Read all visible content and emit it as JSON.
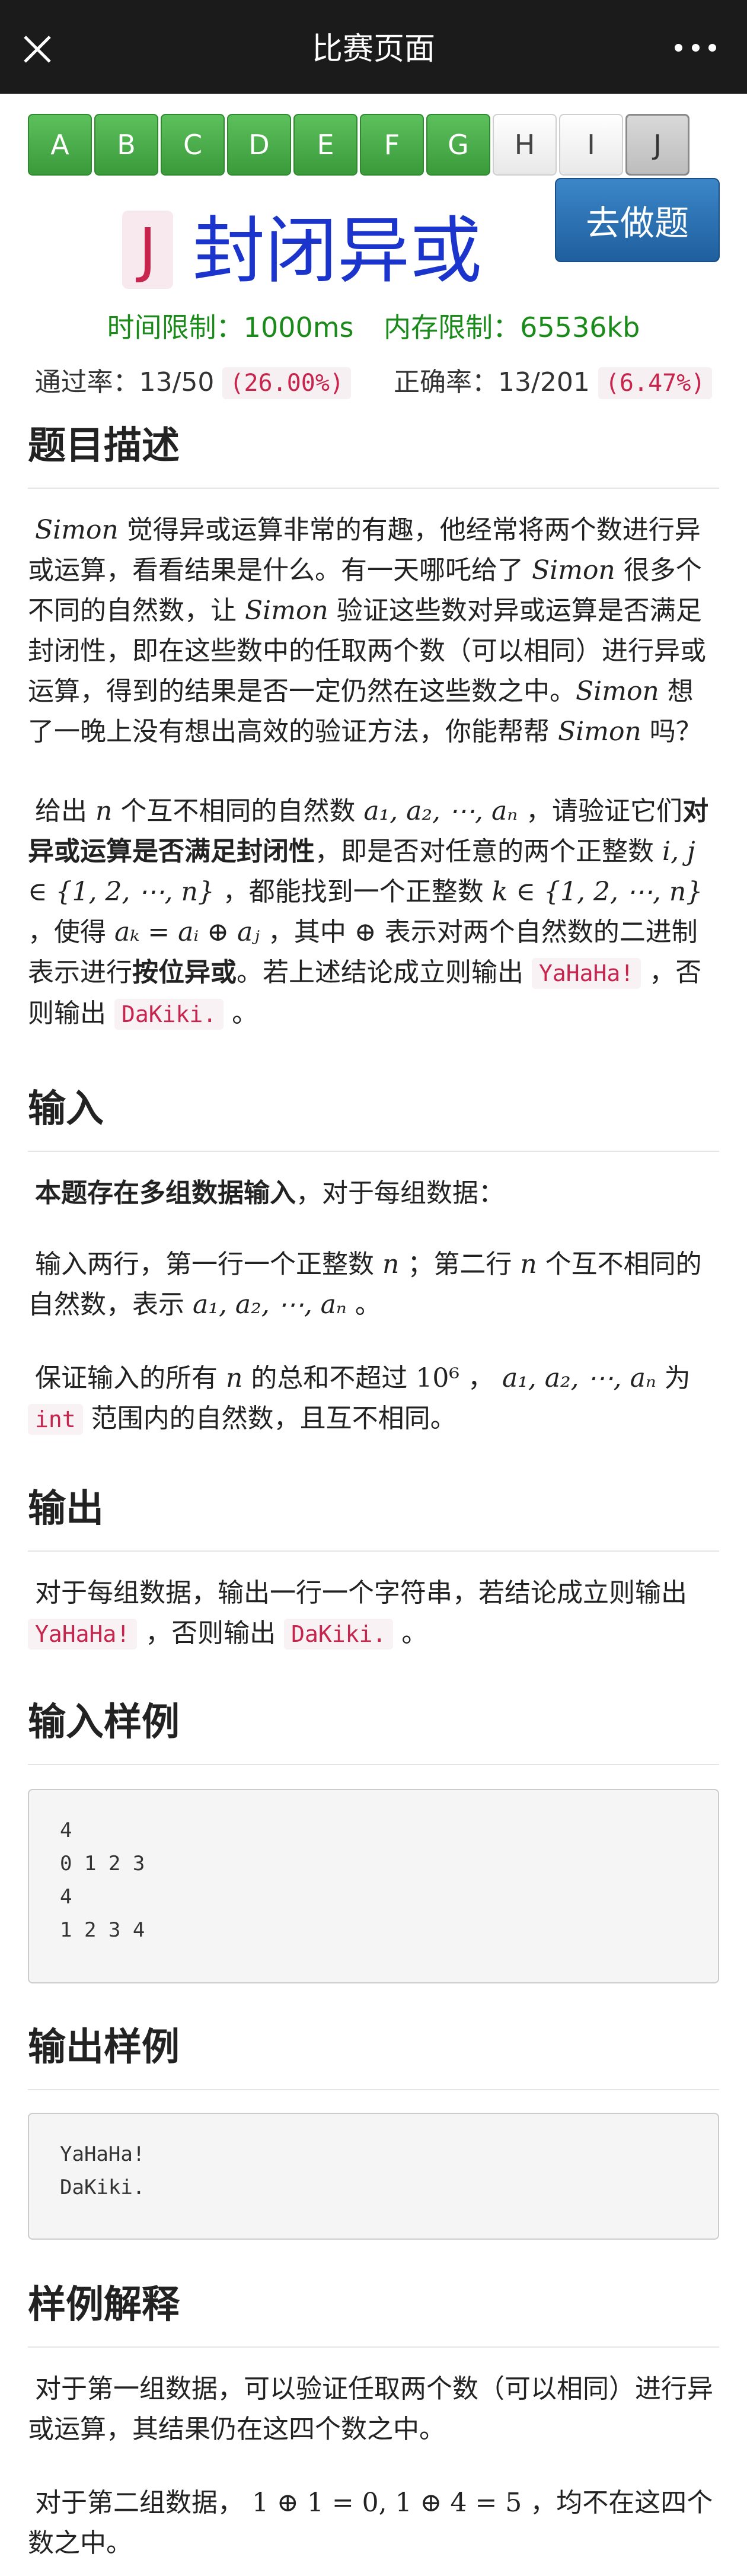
{
  "header": {
    "title": "比赛页面",
    "close_icon": "close-icon",
    "more_icon": "more-horizontal-icon"
  },
  "tabs": [
    {
      "label": "A",
      "state": "solved"
    },
    {
      "label": "B",
      "state": "solved"
    },
    {
      "label": "C",
      "state": "solved"
    },
    {
      "label": "D",
      "state": "solved"
    },
    {
      "label": "E",
      "state": "solved"
    },
    {
      "label": "F",
      "state": "solved"
    },
    {
      "label": "G",
      "state": "solved"
    },
    {
      "label": "H",
      "state": "open"
    },
    {
      "label": "I",
      "state": "open"
    },
    {
      "label": "J",
      "state": "current"
    }
  ],
  "problem": {
    "letter": "J",
    "title": "封闭异或",
    "go_button": "去做题",
    "time_limit": "时间限制：1000ms",
    "memory_limit": "内存限制：65536kb",
    "pass_label": "通过率：13/50",
    "pass_pct": "(26.00%)",
    "correct_label": "正确率：13/201",
    "correct_pct": "(6.47%)"
  },
  "sections": {
    "description": "题目描述",
    "input": "输入",
    "output": "输出",
    "sample_input": "输入样例",
    "sample_output": "输出样例",
    "explanation": "样例解释"
  },
  "desc": {
    "p1": {
      "simon": "Simon",
      "t1": " 觉得异或运算非常的有趣，他经常将两个数进行异或运算，看看结果是什么。有一天哪吒给了 ",
      "t2": " 很多个不同的自然数，让 ",
      "t3": " 验证这些数对异或运算是否满足封闭性，即在这些数中的任取两个数（可以相同）进行异或运算，得到的结果是否一定仍然在这些数之中。",
      "t4": " 想了一晚上没有想出高效的验证方法，你能帮帮 ",
      "t5": " 吗？"
    },
    "p2": {
      "a": "给出 ",
      "n": "n",
      "b": " 个互不相同的自然数 ",
      "seq": "a₁, a₂, ⋯, aₙ",
      "c": " ，请验证它们",
      "bold1": "对异或运算是否满足封闭性",
      "d": "，即是否对任意的两个正整数 ",
      "ij": "i, j ∈ {1, 2, ⋯, n}",
      "e": " ，都能找到一个正整数 ",
      "k": "k ∈ {1, 2, ⋯, n}",
      "f": " ，使得 ",
      "eq": "aₖ = aᵢ ⊕ aⱼ",
      "g": " ，其中 ",
      "xor": "⊕",
      "h": " 表示对两个自然数的二进制表示进行",
      "bold2": "按位异或",
      "i": "。若上述结论成立则输出 ",
      "yes": "YaHaHa!",
      "j": " ，否则输出 ",
      "no": "DaKiki.",
      "end": " 。"
    }
  },
  "input": {
    "p1_bold": "本题存在多组数据输入",
    "p1_rest": "，对于每组数据：",
    "p2_a": "输入两行，第一行一个正整数 ",
    "p2_n": "n",
    "p2_b": " ；第二行 ",
    "p2_n2": "n",
    "p2_c": " 个互不相同的自然数，表示 ",
    "p2_seq": "a₁, a₂, ⋯, aₙ",
    "p2_d": " 。",
    "p3_a": "保证输入的所有 ",
    "p3_n": "n",
    "p3_b": " 的总和不超过 ",
    "p3_pow": "10⁶",
    "p3_c": " ， ",
    "p3_seq": "a₁, a₂, ⋯, aₙ",
    "p3_d": " 为 ",
    "p3_int": "int",
    "p3_e": " 范围内的自然数，且互不相同。"
  },
  "output": {
    "a": "对于每组数据，输出一行一个字符串，若结论成立则输出 ",
    "yes": "YaHaHa!",
    "b": " ，否则输出 ",
    "no": "DaKiki.",
    "c": " 。"
  },
  "sample_input": [
    "4",
    "0 1 2 3",
    "4",
    "1 2 3 4"
  ],
  "sample_output": [
    "YaHaHa!",
    "DaKiki."
  ],
  "explanation": {
    "p1": "对于第一组数据，可以验证任取两个数（可以相同）进行异或运算，其结果仍在这四个数之中。",
    "p2_a": "对于第二组数据， ",
    "p2_math": "1 ⊕ 1 = 0, 1 ⊕ 4 = 5",
    "p2_b": " ，均不在这四个数之中。"
  }
}
